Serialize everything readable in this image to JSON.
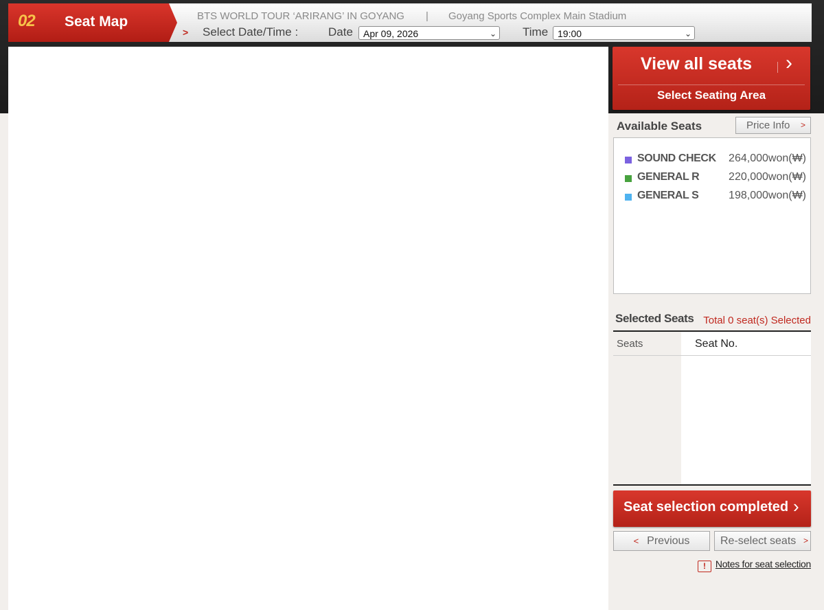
{
  "header": {
    "step_number": "02",
    "step_title": "Seat Map",
    "event_title": "BTS WORLD TOUR ‘ARIRANG’ IN GOYANG",
    "separator": "|",
    "venue": "Goyang Sports Complex Main Stadium",
    "select_label": "Select Date/Time :",
    "date_label": "Date",
    "date_value": "Apr 09, 2026",
    "time_label": "Time",
    "time_value": "19:00"
  },
  "right_panel": {
    "view_all": "View all seats",
    "select_area": "Select Seating Area",
    "available_label": "Available Seats",
    "price_info": "Price Info",
    "grades": [
      {
        "name": "SOUND CHECK",
        "price": "264,000won(₩)",
        "color": "#7b62e0"
      },
      {
        "name": "GENERAL R",
        "price": "220,000won(₩)",
        "color": "#48a23f"
      },
      {
        "name": "GENERAL S",
        "price": "198,000won(₩)",
        "color": "#4fb3f0"
      }
    ],
    "selected_label": "Selected Seats",
    "selected_total": "Total 0 seat(s) Selected",
    "table_header_seats": "Seats",
    "table_header_seat_no": "Seat No.",
    "complete_button": "Seat selection completed",
    "previous_button": "Previous",
    "reselect_button": "Re-select seats",
    "notes_link": "Notes for seat selection"
  },
  "colors": {
    "accent_red": "#c9291f",
    "step_number": "#f7c24a"
  }
}
